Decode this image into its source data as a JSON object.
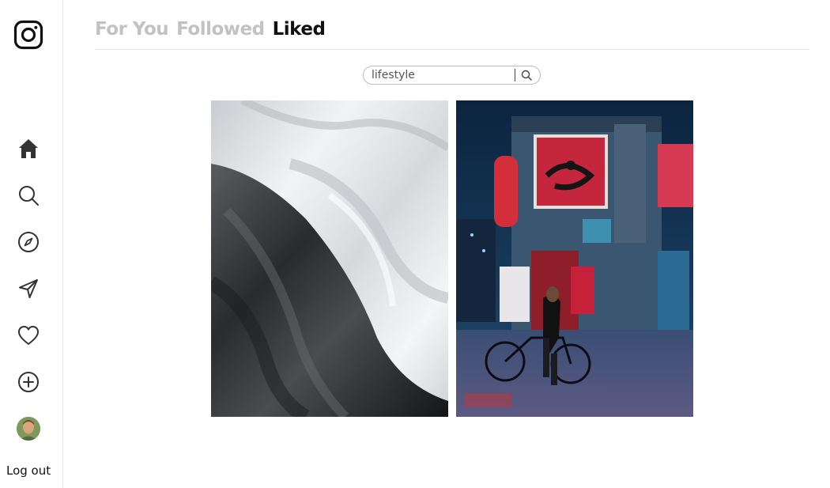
{
  "sidebar": {
    "logo": "instagram-logo",
    "items": [
      {
        "name": "home",
        "icon": "home-icon"
      },
      {
        "name": "search",
        "icon": "search-icon"
      },
      {
        "name": "explore",
        "icon": "compass-icon"
      },
      {
        "name": "messages",
        "icon": "send-icon"
      },
      {
        "name": "notifications",
        "icon": "heart-icon"
      },
      {
        "name": "create",
        "icon": "plus-circle-icon"
      },
      {
        "name": "profile",
        "icon": "avatar"
      }
    ],
    "logout_label": "Log out"
  },
  "tabs": [
    {
      "label": "For You",
      "active": false
    },
    {
      "label": "Followed",
      "active": false
    },
    {
      "label": "Liked",
      "active": true
    }
  ],
  "search": {
    "value": "lifestyle"
  },
  "posts": [
    {
      "subject": "black and white fabric"
    },
    {
      "subject": "neon street night with bicycle"
    }
  ],
  "colors": {
    "inactive_tab": "#c2c2c2",
    "active_tab": "#111111",
    "border": "#e4e4e4"
  }
}
